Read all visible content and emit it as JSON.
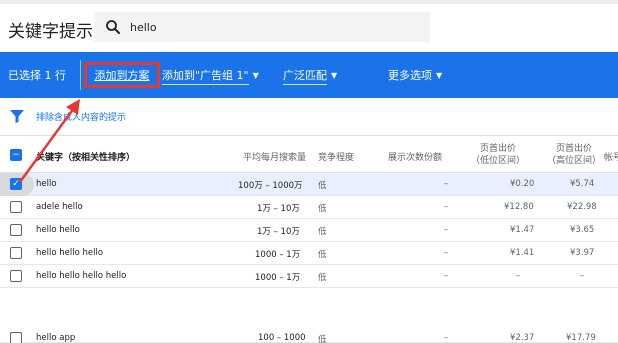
{
  "header": {
    "title": "关键字提示",
    "search_value": "hello"
  },
  "toolbar": {
    "selected_count": "已选择 1 行",
    "add_to_plan": "添加到方案",
    "add_to_adgroup": "添加到\"广告组 1\"",
    "match_type": "广泛匹配",
    "more_options": "更多选项"
  },
  "filter": {
    "text": "排除含成人内容的提示"
  },
  "table": {
    "columns": {
      "keyword": "关键字（按相关性排序）",
      "monthly": "平均每月搜索量",
      "competition": "竞争程度",
      "impression_share": "展示次数份额",
      "bid_low_1": "页首出价",
      "bid_low_2": "（低位区间）",
      "bid_high_1": "页首出价",
      "bid_high_2": "（高位区间）",
      "account": "帐号"
    },
    "rows": [
      {
        "keyword": "hello",
        "monthly": "100万 – 1000万",
        "competition": "低",
        "share": "–",
        "bid_low": "¥0.20",
        "bid_high": "¥5.74",
        "checked": true
      },
      {
        "keyword": "adele hello",
        "monthly": "1万 – 10万",
        "competition": "低",
        "share": "–",
        "bid_low": "¥12.80",
        "bid_high": "¥22.98",
        "checked": false
      },
      {
        "keyword": "hello hello",
        "monthly": "1万 – 10万",
        "competition": "低",
        "share": "–",
        "bid_low": "¥1.47",
        "bid_high": "¥3.65",
        "checked": false
      },
      {
        "keyword": "hello hello hello",
        "monthly": "1000 – 1万",
        "competition": "低",
        "share": "–",
        "bid_low": "¥1.41",
        "bid_high": "¥3.97",
        "checked": false
      },
      {
        "keyword": "hello hello hello hello",
        "monthly": "1000 – 1万",
        "competition": "低",
        "share": "–",
        "bid_low": "–",
        "bid_high": "–",
        "checked": false
      },
      {
        "keyword": "hello app",
        "monthly": "100 – 1000",
        "competition": "低",
        "share": "–",
        "bid_low": "¥2.37",
        "bid_high": "¥17.79",
        "checked": false
      }
    ]
  },
  "colors": {
    "toolbar_bg": "#1a73e8",
    "highlight_border": "#e53935",
    "annotation_arrow": "#e53935",
    "link_blue": "#1a73e8"
  }
}
